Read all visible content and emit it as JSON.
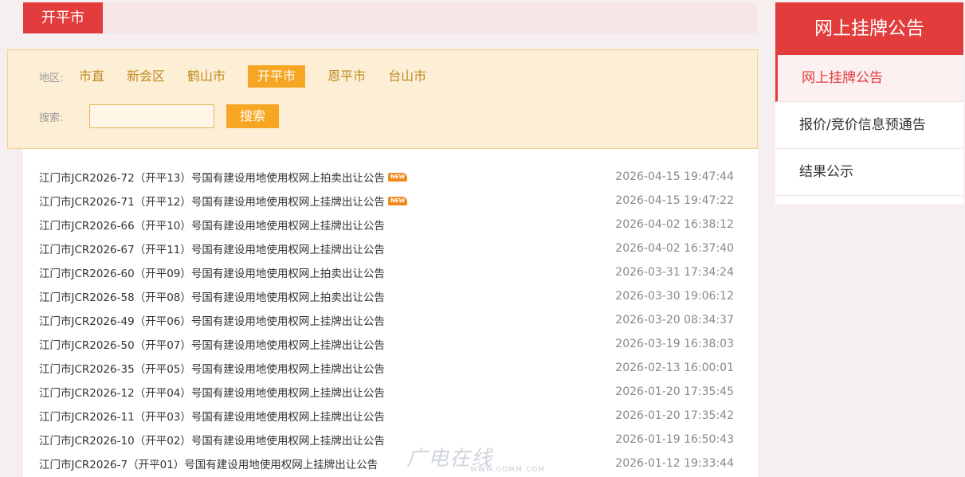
{
  "header": {
    "city_tag": "开平市"
  },
  "filter": {
    "region_label": "地区:",
    "regions": [
      "市直",
      "新会区",
      "鹤山市",
      "开平市",
      "恩平市",
      "台山市"
    ],
    "active_region": "开平市",
    "search_label": "搜索:",
    "search_value": "",
    "search_button": "搜索"
  },
  "list": {
    "new_badge": "NEW",
    "items": [
      {
        "title": "江门市JCR2026-72（开平13）号国有建设用地使用权网上拍卖出让公告",
        "date": "2026-04-15 19:47:44",
        "is_new": true
      },
      {
        "title": "江门市JCR2026-71（开平12）号国有建设用地使用权网上挂牌出让公告",
        "date": "2026-04-15 19:47:22",
        "is_new": true
      },
      {
        "title": "江门市JCR2026-66（开平10）号国有建设用地使用权网上挂牌出让公告",
        "date": "2026-04-02 16:38:12",
        "is_new": false
      },
      {
        "title": "江门市JCR2026-67（开平11）号国有建设用地使用权网上挂牌出让公告",
        "date": "2026-04-02 16:37:40",
        "is_new": false
      },
      {
        "title": "江门市JCR2026-60（开平09）号国有建设用地使用权网上拍卖出让公告",
        "date": "2026-03-31 17:34:24",
        "is_new": false
      },
      {
        "title": "江门市JCR2026-58（开平08）号国有建设用地使用权网上拍卖出让公告",
        "date": "2026-03-30 19:06:12",
        "is_new": false
      },
      {
        "title": "江门市JCR2026-49（开平06）号国有建设用地使用权网上挂牌出让公告",
        "date": "2026-03-20 08:34:37",
        "is_new": false
      },
      {
        "title": "江门市JCR2026-50（开平07）号国有建设用地使用权网上挂牌出让公告",
        "date": "2026-03-19 16:38:03",
        "is_new": false
      },
      {
        "title": "江门市JCR2026-35（开平05）号国有建设用地使用权网上挂牌出让公告",
        "date": "2026-02-13 16:00:01",
        "is_new": false
      },
      {
        "title": "江门市JCR2026-12（开平04）号国有建设用地使用权网上挂牌出让公告",
        "date": "2026-01-20 17:35:45",
        "is_new": false
      },
      {
        "title": "江门市JCR2026-11（开平03）号国有建设用地使用权网上挂牌出让公告",
        "date": "2026-01-20 17:35:42",
        "is_new": false
      },
      {
        "title": "江门市JCR2026-10（开平02）号国有建设用地使用权网上挂牌出让公告",
        "date": "2026-01-19 16:50:43",
        "is_new": false
      },
      {
        "title": "江门市JCR2026-7（开平01）号国有建设用地使用权网上挂牌出让公告",
        "date": "2026-01-12 19:33:44",
        "is_new": false
      }
    ]
  },
  "watermark": {
    "text": "广电在线",
    "url": "WWW.GDMM.COM"
  },
  "sidebar": {
    "title": "网上挂牌公告",
    "items": [
      "网上挂牌公告",
      "报价/竞价信息预通告",
      "结果公示"
    ],
    "active_index": 0
  },
  "colors": {
    "brand_red": "#e23c3c",
    "accent_orange": "#f6a623"
  }
}
